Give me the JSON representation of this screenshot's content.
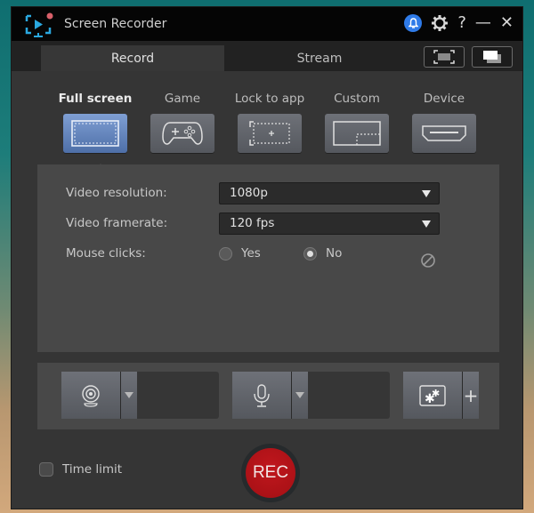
{
  "window": {
    "title": "Screen Recorder",
    "controls": {
      "help": "?",
      "minimize": "—",
      "close": "✕"
    }
  },
  "tabs": [
    {
      "label": "Record",
      "active": true
    },
    {
      "label": "Stream",
      "active": false
    }
  ],
  "capture_modes": [
    {
      "label": "Full screen",
      "icon": "full-screen-icon",
      "selected": true
    },
    {
      "label": "Game",
      "icon": "gamepad-icon",
      "selected": false
    },
    {
      "label": "Lock to app",
      "icon": "lock-to-app-icon",
      "selected": false
    },
    {
      "label": "Custom",
      "icon": "custom-region-icon",
      "selected": false
    },
    {
      "label": "Device",
      "icon": "hdmi-icon",
      "selected": false
    }
  ],
  "settings": {
    "resolution": {
      "label": "Video resolution:",
      "value": "1080p"
    },
    "framerate": {
      "label": "Video framerate:",
      "value": "120 fps"
    },
    "mouse_clicks": {
      "label": "Mouse clicks:",
      "options": [
        "Yes",
        "No"
      ],
      "selected": "No"
    }
  },
  "devices": {
    "webcam": {
      "icon": "webcam-icon"
    },
    "microphone": {
      "icon": "microphone-icon"
    },
    "effects": {
      "icon": "effects-icon",
      "add": "+"
    }
  },
  "footer": {
    "time_limit": {
      "label": "Time limit",
      "checked": false
    },
    "rec_label": "REC"
  },
  "colors": {
    "accent_blue": "#2f7be8",
    "selected_mode": "#6a8cc4",
    "rec_red": "#b31218",
    "app_icon_cyan": "#2aa8e0"
  }
}
